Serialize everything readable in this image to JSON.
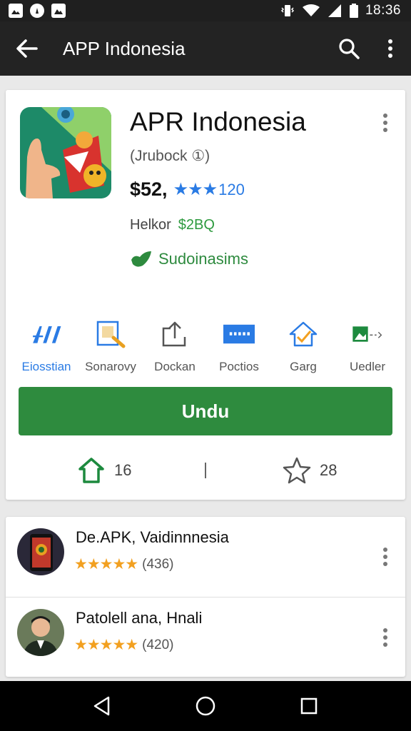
{
  "status_bar": {
    "time": "18:36"
  },
  "toolbar": {
    "title": "APP Indonesia"
  },
  "app": {
    "title": "APR Indonesia",
    "developer": "(Jrubock ①)",
    "price": "$52,",
    "stars": "★★★",
    "rating_count": "120",
    "helper_label": "Helkor",
    "helper_value": "$2BQ",
    "verified_label": "Sudoinasims"
  },
  "categories": [
    {
      "label": "Eiosstian"
    },
    {
      "label": "Sonarovy"
    },
    {
      "label": "Dockan"
    },
    {
      "label": "Poctios"
    },
    {
      "label": "Garg"
    },
    {
      "label": "Uedler"
    }
  ],
  "install_button": {
    "label": "Undu"
  },
  "stats": {
    "shares": "16",
    "stars": "28"
  },
  "list": [
    {
      "title": "De.APK, Vaidinnnesia",
      "stars": "★★★★★",
      "count": "(436)"
    },
    {
      "title": "Patolell ana, Hnali",
      "stars": "★★★★★",
      "count": "(420)"
    }
  ],
  "colors": {
    "accent_blue": "#2a7be4",
    "install_green": "#2e8b3e",
    "star_orange": "#f2a020"
  },
  "icons": [
    "back-icon",
    "search-icon",
    "more-vert-icon",
    "share-icon",
    "star-icon",
    "back-nav-icon",
    "home-nav-icon",
    "recents-nav-icon"
  ]
}
